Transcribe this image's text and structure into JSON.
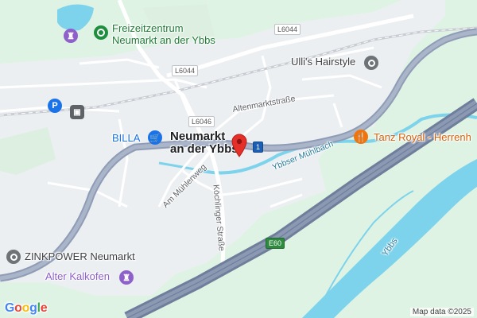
{
  "map": {
    "places": {
      "freizeit_line1": "Freizeitzentrum",
      "freizeit_line2": "Neumarkt an der Ybbs",
      "hairstyle": "Ulli's Hairstyle",
      "billa": "BILLA",
      "town_line1": "Neumarkt",
      "town_line2": "an der Ybbs",
      "tanz": "Tanz Royal - Herrenh",
      "zinkpower": "ZINKPOWER Neumarkt",
      "kalkofen": "Alter Kalkofen"
    },
    "streets": {
      "altenmarkt": "Altenmarktstraße",
      "muehlenweg": "Am Mühlenweg",
      "koechlinger": "Köchlinger Straße",
      "muehlbach": "Ybbser Mühlbach",
      "ybbs": "Ybbs"
    },
    "road_shields": {
      "l6044_top": "L6044",
      "l6044_mid": "L6044",
      "l6046": "L6046",
      "route_1": "1",
      "e60": "E60"
    },
    "icons": {
      "park": "P",
      "train": "train-icon",
      "freizeit": "castle-icon",
      "hairstyle": "place-icon",
      "billa": "shopping-cart-icon",
      "tanz": "restaurant-icon",
      "zinkpower": "place-icon",
      "kalkofen": "castle-icon",
      "pin": "location-pin-icon"
    },
    "colors": {
      "land": "#dff3e4",
      "urban": "#eceff1",
      "water": "#7dd3ec",
      "motorway": "#7a8aa6",
      "major_road": "#8e9cb6",
      "pin": "#e5302a",
      "poi_purple": "#8e60c9",
      "poi_green": "#1e8e3e",
      "poi_blue": "#1a73e8",
      "poi_orange": "#f2750c",
      "poi_gray": "#6e7378"
    }
  },
  "branding": {
    "logo": "Google",
    "attribution": "Map data ©2025"
  }
}
